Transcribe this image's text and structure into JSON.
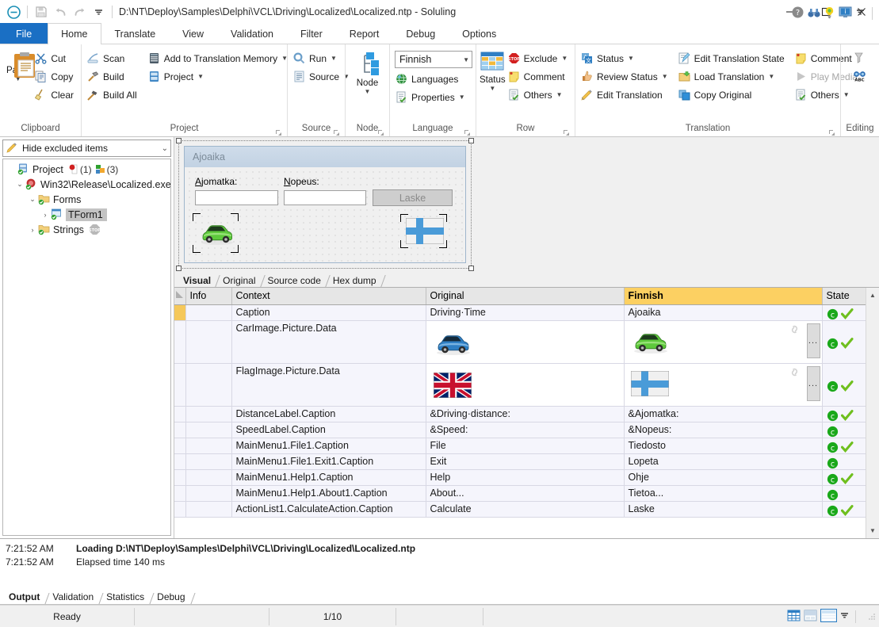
{
  "titlebar": {
    "title": "D:\\NT\\Deploy\\Samples\\Delphi\\VCL\\Driving\\Localized\\Localized.ntp  -  Soluling",
    "qat": [
      {
        "name": "app-menu-icon",
        "label": "Soluling"
      },
      {
        "name": "save-icon",
        "label": "Save"
      },
      {
        "name": "undo-icon",
        "label": "Undo"
      },
      {
        "name": "redo-icon",
        "label": "Redo"
      },
      {
        "name": "customize-qat-icon",
        "label": "Customize Quick Access Toolbar"
      }
    ],
    "window_controls": [
      {
        "name": "minimize-button",
        "glyph": "─"
      },
      {
        "name": "maximize-button",
        "glyph": "□"
      },
      {
        "name": "close-button",
        "glyph": "✕"
      }
    ],
    "help_cluster": [
      {
        "name": "help-icon",
        "label": "Help"
      },
      {
        "name": "binoculars-icon",
        "label": "Find"
      },
      {
        "name": "tips-icon",
        "label": "Tips"
      },
      {
        "name": "info-screen-icon",
        "label": "Information"
      },
      {
        "name": "ribbon-options-icon",
        "label": "Ribbon Display Options"
      }
    ]
  },
  "ribbon": {
    "tabs": [
      {
        "label": "File",
        "kind": "file"
      },
      {
        "label": "Home",
        "kind": "active"
      },
      {
        "label": "Translate",
        "kind": "normal"
      },
      {
        "label": "View",
        "kind": "normal"
      },
      {
        "label": "Validation",
        "kind": "normal"
      },
      {
        "label": "Filter",
        "kind": "normal"
      },
      {
        "label": "Report",
        "kind": "normal"
      },
      {
        "label": "Debug",
        "kind": "normal"
      },
      {
        "label": "Options",
        "kind": "normal"
      }
    ],
    "groups": {
      "clipboard": {
        "label": "Clipboard",
        "paste": "Paste",
        "items": [
          {
            "label": "Cut",
            "icon": "scissors-icon"
          },
          {
            "label": "Copy",
            "icon": "copy-icon"
          },
          {
            "label": "Clear",
            "icon": "broom-icon"
          }
        ]
      },
      "project": {
        "label": "Project",
        "col1": [
          {
            "label": "Scan",
            "icon": "scan-icon"
          },
          {
            "label": "Build",
            "icon": "hammer-icon"
          },
          {
            "label": "Build All",
            "icon": "sledgehammer-icon"
          }
        ],
        "col2": [
          {
            "label": "Add to Translation Memory",
            "icon": "memory-icon",
            "caret": true
          },
          {
            "label": "Project",
            "icon": "project-icon",
            "caret": true
          }
        ]
      },
      "source": {
        "label": "Source",
        "items": [
          {
            "label": "Run",
            "icon": "run-icon",
            "caret": true
          },
          {
            "label": "Source",
            "icon": "source-icon",
            "caret": true
          }
        ]
      },
      "node": {
        "label": "Node",
        "button": "Node"
      },
      "language": {
        "label": "Language",
        "selected": "Finnish",
        "items": [
          {
            "label": "Languages",
            "icon": "globe-icon"
          },
          {
            "label": "Properties",
            "icon": "properties-icon",
            "caret": true
          }
        ]
      },
      "row": {
        "label": "Row",
        "button": "Status",
        "items": [
          {
            "label": "Exclude",
            "icon": "stop-icon",
            "caret": true
          },
          {
            "label": "Comment",
            "icon": "note-icon"
          },
          {
            "label": "Others",
            "icon": "others-icon",
            "caret": true
          }
        ]
      },
      "translation": {
        "label": "Translation",
        "col1": [
          {
            "label": "Status",
            "icon": "status-icon",
            "caret": true
          },
          {
            "label": "Review Status",
            "icon": "review-icon",
            "caret": true
          },
          {
            "label": "Edit Translation",
            "icon": "pencil-icon"
          }
        ],
        "col2": [
          {
            "label": "Edit Translation State",
            "icon": "edit-state-icon"
          },
          {
            "label": "Load Translation",
            "icon": "load-icon",
            "caret": true
          },
          {
            "label": "Copy Original",
            "icon": "copy-original-icon"
          }
        ],
        "col3": [
          {
            "label": "Comment",
            "icon": "note-icon"
          },
          {
            "label": "Play Media",
            "icon": "play-icon",
            "disabled": true
          },
          {
            "label": "Others",
            "icon": "others-icon",
            "caret": true
          }
        ]
      },
      "editing": {
        "label": "Editing",
        "items": [
          {
            "label": "",
            "icon": "funnel-icon"
          },
          {
            "label": "",
            "icon": "spelling-icon"
          }
        ]
      }
    }
  },
  "sidebar": {
    "filter": "Hide excluded items",
    "tree": [
      {
        "label": "Project",
        "depth": 0,
        "icon": "project-node-icon",
        "twisty": "",
        "badges": [
          "(1)",
          "(3)"
        ]
      },
      {
        "label": "Win32\\Release\\Localized.exe",
        "depth": 1,
        "icon": "exe-node-icon",
        "twisty": "expanded"
      },
      {
        "label": "Forms",
        "depth": 2,
        "icon": "folder-node-icon",
        "twisty": "expanded"
      },
      {
        "label": "TForm1",
        "depth": 3,
        "icon": "form-node-icon",
        "twisty": "collapsed",
        "selected": true
      },
      {
        "label": "Strings",
        "depth": 2,
        "icon": "strings-node-icon",
        "twisty": "collapsed",
        "stopbadge": true
      }
    ]
  },
  "preview": {
    "form_title": "Ajoaika",
    "distance_label": "Ajomatka:",
    "distance_mnemonic": "A",
    "speed_label": "Nopeus:",
    "speed_mnemonic": "N",
    "button": "Laske",
    "car_image": "green-car-image",
    "flag_image": "finland-flag-image"
  },
  "view_tabs": [
    {
      "label": "Visual",
      "active": true
    },
    {
      "label": "Original",
      "active": false
    },
    {
      "label": "Source code",
      "active": false
    },
    {
      "label": "Hex dump",
      "active": false
    }
  ],
  "grid": {
    "columns": [
      "",
      "Info",
      "Context",
      "Original",
      "Finnish",
      "State"
    ],
    "rows": [
      {
        "context": "Caption",
        "original": "Driving·Time",
        "finnish": "Ajoaika",
        "state": [
          "c",
          "check"
        ],
        "current": true,
        "selected": true,
        "tall": false
      },
      {
        "context": "CarImage.Picture.Data",
        "original": "blue-car-image",
        "finnish": "green-car-image",
        "state": [
          "c",
          "check"
        ],
        "tall": true,
        "image": true
      },
      {
        "context": "FlagImage.Picture.Data",
        "original": "uk-flag-image",
        "finnish": "finland-flag-image",
        "state": [
          "c",
          "check"
        ],
        "tall": true,
        "image": true
      },
      {
        "context": "DistanceLabel.Caption",
        "original": "&Driving·distance:",
        "finnish": "&Ajomatka:",
        "state": [
          "c",
          "check"
        ],
        "tall": false
      },
      {
        "context": "SpeedLabel.Caption",
        "original": "&Speed:",
        "finnish": "&Nopeus:",
        "state": [
          "c"
        ],
        "tall": false
      },
      {
        "context": "MainMenu1.File1.Caption",
        "original": "File",
        "finnish": "Tiedosto",
        "state": [
          "c",
          "check"
        ],
        "tall": false
      },
      {
        "context": "MainMenu1.File1.Exit1.Caption",
        "original": "Exit",
        "finnish": "Lopeta",
        "state": [
          "c"
        ],
        "tall": false
      },
      {
        "context": "MainMenu1.Help1.Caption",
        "original": "Help",
        "finnish": "Ohje",
        "state": [
          "c",
          "check"
        ],
        "tall": false
      },
      {
        "context": "MainMenu1.Help1.About1.Caption",
        "original": "About...",
        "finnish": "Tietoa...",
        "state": [
          "c"
        ],
        "tall": false
      },
      {
        "context": "ActionList1.CalculateAction.Caption",
        "original": "Calculate",
        "finnish": "Laske",
        "state": [
          "c",
          "check"
        ],
        "tall": false
      }
    ]
  },
  "output": {
    "lines": [
      {
        "time": "7:21:52 AM",
        "message": "Loading D:\\NT\\Deploy\\Samples\\Delphi\\VCL\\Driving\\Localized\\Localized.ntp",
        "bold": true
      },
      {
        "time": "7:21:52 AM",
        "message": "Elapsed time 140 ms",
        "bold": false
      }
    ],
    "tabs": [
      {
        "label": "Output",
        "active": true
      },
      {
        "label": "Validation",
        "active": false
      },
      {
        "label": "Statistics",
        "active": false
      },
      {
        "label": "Debug",
        "active": false
      }
    ]
  },
  "statusbar": {
    "ready": "Ready",
    "cell2": "",
    "cell3": "",
    "position": "1/10",
    "view_buttons": [
      {
        "name": "grid-view-icon",
        "active": false
      },
      {
        "name": "split-view-icon",
        "active": false
      },
      {
        "name": "form-view-icon",
        "active": true
      },
      {
        "name": "view-dropdown-icon",
        "active": false
      }
    ]
  },
  "colors": {
    "file_tab": "#1a6fc4",
    "finnish_header": "#fcd062",
    "current_cell": "#f5c85a",
    "state_green": "#1aa81a",
    "check_green": "#6fbf1e"
  }
}
